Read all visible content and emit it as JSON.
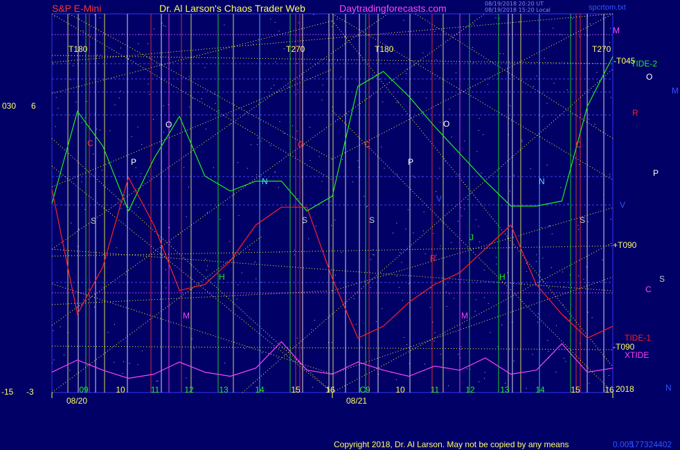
{
  "header": {
    "left_title": "S&P E-Mini",
    "center_title": "Dr. Al Larson's Chaos Trader Web",
    "site": "Daytradingforecasts.com",
    "timestamp_line1": "08/19/2018 20:20 UT",
    "timestamp_line2": "08/19/2018 15:20 Local",
    "file_name": "spcrtom.txt"
  },
  "footer": {
    "copyright": "Copyright 2018, Dr. Al Larson. May not be copied by any means",
    "id_code": "0.005",
    "id_number": "177324402"
  },
  "left_axis": {
    "top_left": "030",
    "top_right": "6",
    "bottom_left": "-15",
    "bottom_right": "-3"
  },
  "right_labels": {
    "m": "M",
    "t045": "-T045",
    "tide2": "TIDE-2",
    "o": "O",
    "m2": "M",
    "r": "R",
    "p": "P",
    "v": "V",
    "t090p": "+T090",
    "s": "S",
    "c": "C",
    "tide1": "TIDE-1",
    "t090m": "-T090",
    "xtide": "XTIDE",
    "n": "N",
    "year": "2018"
  },
  "dates": [
    "08/20",
    "08/21"
  ],
  "hour_labels": [
    "09",
    "10",
    "11",
    "12",
    "13",
    "14",
    "15",
    "16",
    "C9",
    "10",
    "11",
    "12",
    "13",
    "14",
    "15",
    "16"
  ],
  "timing_labels": [
    "T180",
    "T270",
    "T180",
    "T270"
  ],
  "planet_labels": [
    "C",
    "P",
    "O",
    "S",
    "M",
    "H",
    "N",
    "G",
    "S",
    "C",
    "S",
    "O",
    "P",
    "R",
    "M",
    "J",
    "H",
    "N",
    "V",
    "C",
    "S"
  ],
  "colors": {
    "background": "#000066",
    "frame": "#3333ff",
    "red_line": "#ff2222",
    "green_line": "#22ee22",
    "magenta_line": "#ff44ff",
    "yellow_dots": "#ffff33"
  },
  "chart_data": {
    "type": "line",
    "x_categories": [
      "09",
      "10",
      "11",
      "12",
      "13",
      "14",
      "15",
      "16",
      "C9",
      "10",
      "11",
      "12",
      "13",
      "14",
      "15",
      "16"
    ],
    "series": [
      {
        "name": "TIDE-2",
        "color": "#22ee22",
        "values": [
          0.35,
          0.72,
          0.58,
          0.32,
          0.53,
          0.7,
          0.46,
          0.4,
          0.44,
          0.44,
          0.32,
          0.38,
          0.82,
          0.88,
          0.78,
          0.66,
          0.55,
          0.44,
          0.34,
          0.34,
          0.36,
          0.74,
          0.94
        ]
      },
      {
        "name": "TIDE-1",
        "color": "#ff2222",
        "values": [
          0.62,
          0.2,
          0.36,
          0.66,
          0.5,
          0.28,
          0.3,
          0.38,
          0.5,
          0.56,
          0.56,
          0.32,
          0.12,
          0.16,
          0.24,
          0.3,
          0.34,
          0.42,
          0.5,
          0.3,
          0.2,
          0.12,
          0.16
        ]
      },
      {
        "name": "XTIDE",
        "color": "#ff44ff",
        "values": [
          0.2,
          0.32,
          0.22,
          0.14,
          0.18,
          0.3,
          0.2,
          0.16,
          0.24,
          0.5,
          0.22,
          0.18,
          0.3,
          0.22,
          0.16,
          0.26,
          0.22,
          0.34,
          0.18,
          0.22,
          0.48,
          0.2,
          0.24
        ]
      }
    ]
  }
}
